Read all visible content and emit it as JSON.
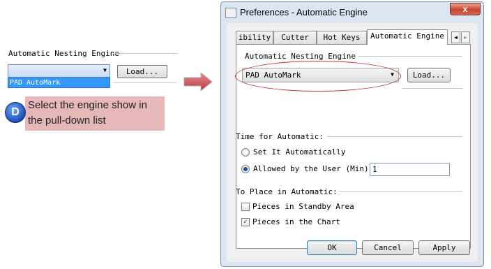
{
  "left": {
    "group_label": "Automatic Nesting Engine",
    "dropdown_option": "PAD AutoMark",
    "load_label": "Load...",
    "step_badge": "D",
    "instruction": "Select the engine show in the pull-down list"
  },
  "dialog": {
    "title": "Preferences - Automatic Engine",
    "close_label": "x",
    "tabs": [
      {
        "label": "ibility"
      },
      {
        "label": "Cutter"
      },
      {
        "label": "Hot Keys"
      },
      {
        "label": "Automatic Engine"
      }
    ],
    "engine_group_label": "Automatic Nesting Engine",
    "engine_value": "PAD AutoMark",
    "load_label": "Load...",
    "time_group_label": "Time for Automatic:",
    "time_options": [
      {
        "label": "Set It Automatically",
        "selected": false
      },
      {
        "label": "Allowed by the User (Min):",
        "selected": true
      }
    ],
    "minutes_value": "1",
    "place_group_label": "To Place in Automatic:",
    "place_options": [
      {
        "label": "Pieces in Standby Area",
        "checked": false
      },
      {
        "label": "Pieces in the Chart",
        "checked": true
      }
    ],
    "buttons": {
      "ok": "OK",
      "cancel": "Cancel",
      "apply": "Apply"
    }
  },
  "colors": {
    "highlight_box": "#e6b8b8",
    "annotation_red": "#c0393b",
    "arrow_fill": "#c9545a",
    "selection_blue": "#3399ff"
  }
}
